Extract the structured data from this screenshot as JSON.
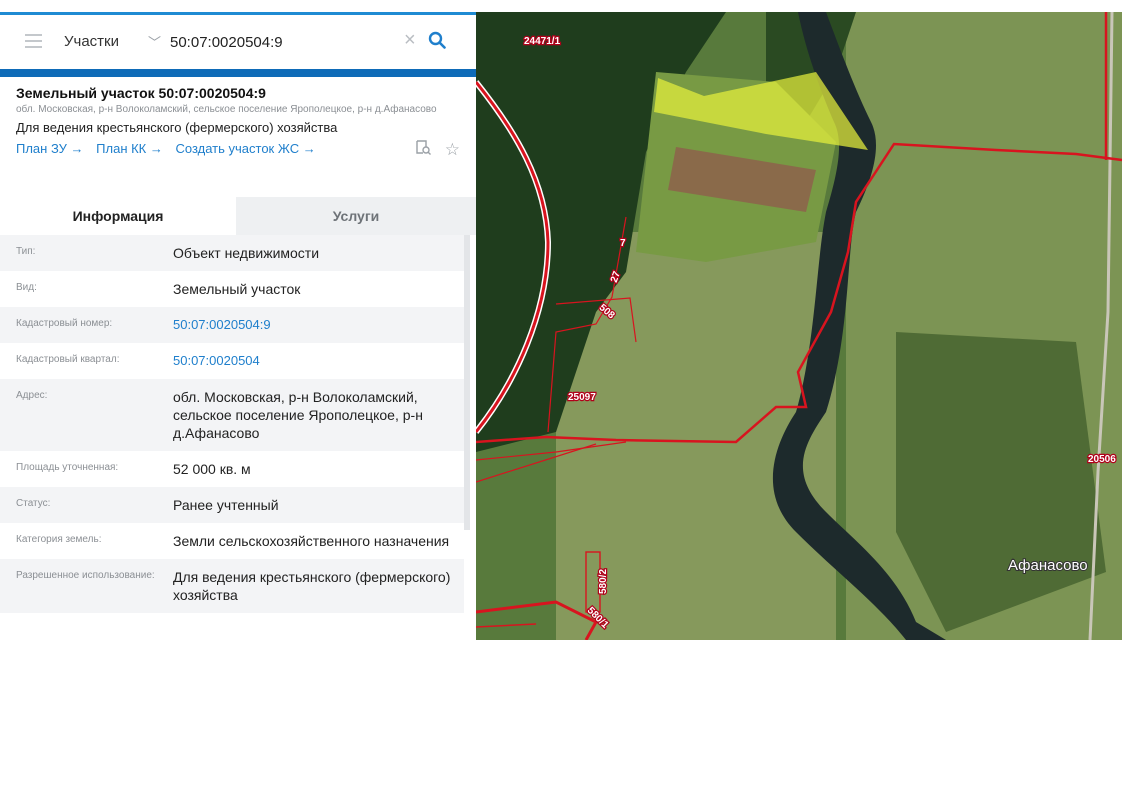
{
  "search": {
    "type_label": "Участки",
    "query": "50:07:0020504:9"
  },
  "parcel": {
    "title": "Земельный участок 50:07:0020504:9",
    "address": "обл. Московская, р-н Волоколамский, сельское поселение Ярополецкое, р-н д.Афанасово",
    "usage": "Для ведения крестьянского (фермерского) хозяйства",
    "links": [
      "План ЗУ →",
      "План КК →",
      "Создать участок ЖС →"
    ]
  },
  "tabs": [
    "Информация",
    "Услуги"
  ],
  "rows": [
    {
      "label": "Тип:",
      "value": "Объект недвижимости"
    },
    {
      "label": "Вид:",
      "value": "Земельный участок"
    },
    {
      "label": "Кадастровый номер:",
      "value": "50:07:0020504:9"
    },
    {
      "label": "Кадастровый квартал:",
      "value": "50:07:0020504"
    },
    {
      "label": "Адрес:",
      "value": "обл. Московская, р-н Волоколамский, сельское поселение Ярополецкое, р-н д.Афанасово"
    },
    {
      "label": "Площадь уточненная:",
      "value": "52 000 кв. м"
    },
    {
      "label": "Статус:",
      "value": "Ранее учтенный"
    },
    {
      "label": "Категория земель:",
      "value": "Земли сельскохозяйственного назначения"
    },
    {
      "label": "Разрешенное использование:",
      "value": "Для ведения крестьянского (фермерского) хозяйства"
    }
  ],
  "map": {
    "labels": [
      "24471/1",
      "7",
      "27",
      "508",
      "25097",
      "20506",
      "580/2",
      "580/1"
    ],
    "town": "Афанасово"
  },
  "colors": {
    "accent": "#1f7fcc",
    "boundary": "#d8141f",
    "selected_parcel": "#e6f03c"
  }
}
